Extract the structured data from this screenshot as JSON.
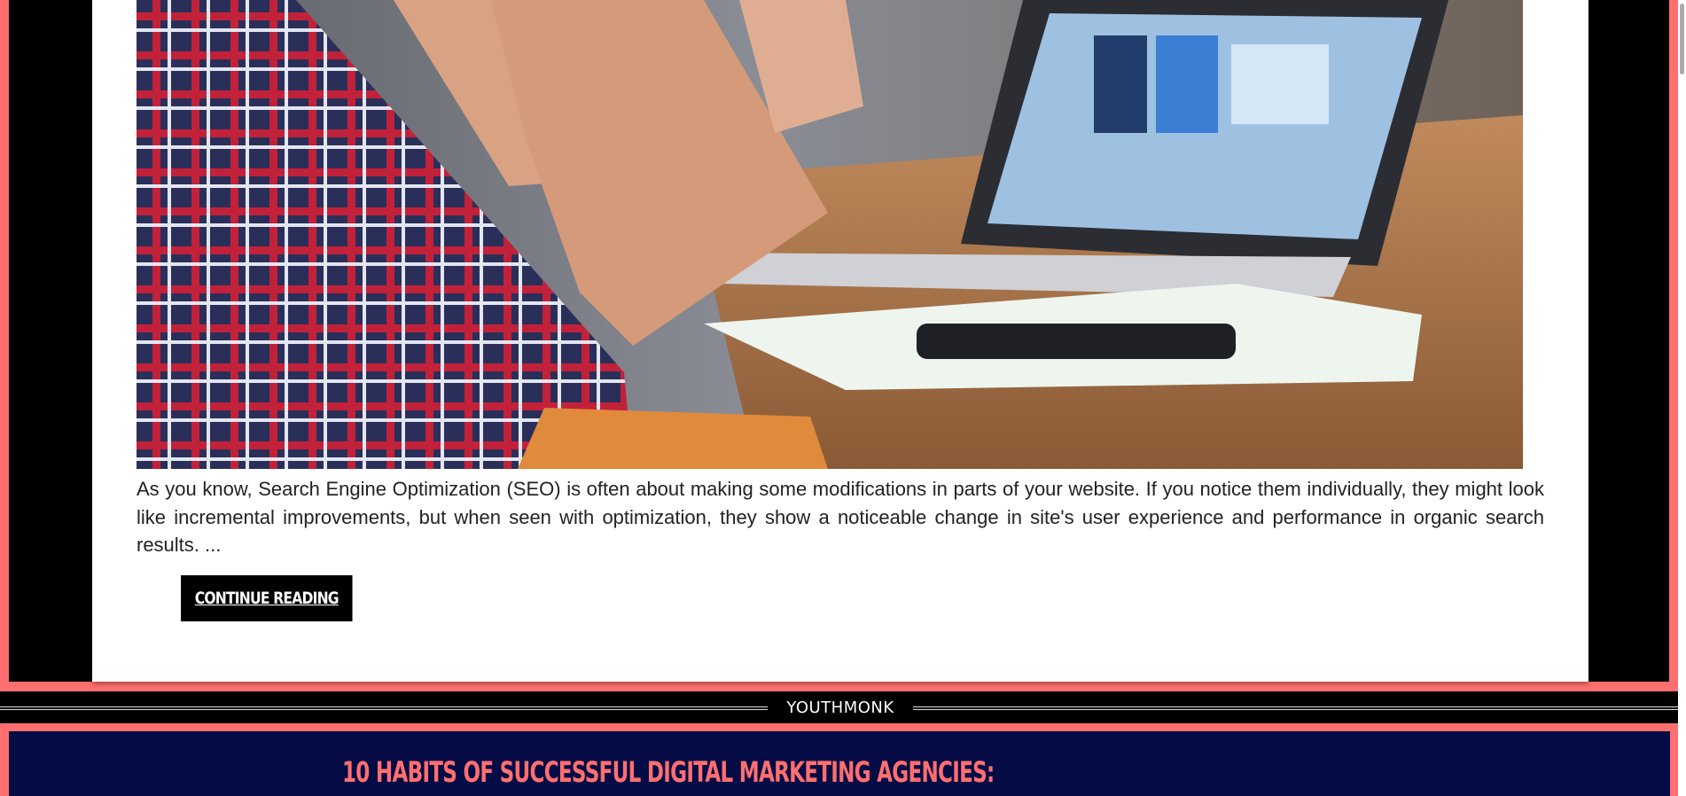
{
  "post": {
    "image_alt": "Person at a desk with laptop, notebook and smartphone",
    "excerpt": "As you know, Search Engine Optimization (SEO) is often about making some modifications in parts of your website. If you notice them individually, they might look like incremental improvements, but when seen with optimization, they show a noticeable change in site's user experience and performance in organic search results. ...",
    "continue_label": "Continue Reading"
  },
  "separator": {
    "label": "YOUTHMONK"
  },
  "next_post": {
    "title": "10 Habits of Successful Digital Marketing Agencies:"
  },
  "colors": {
    "accent_pink": "#ff6f6f",
    "navy": "#050b45",
    "black": "#000000",
    "card_white": "#ffffff"
  }
}
